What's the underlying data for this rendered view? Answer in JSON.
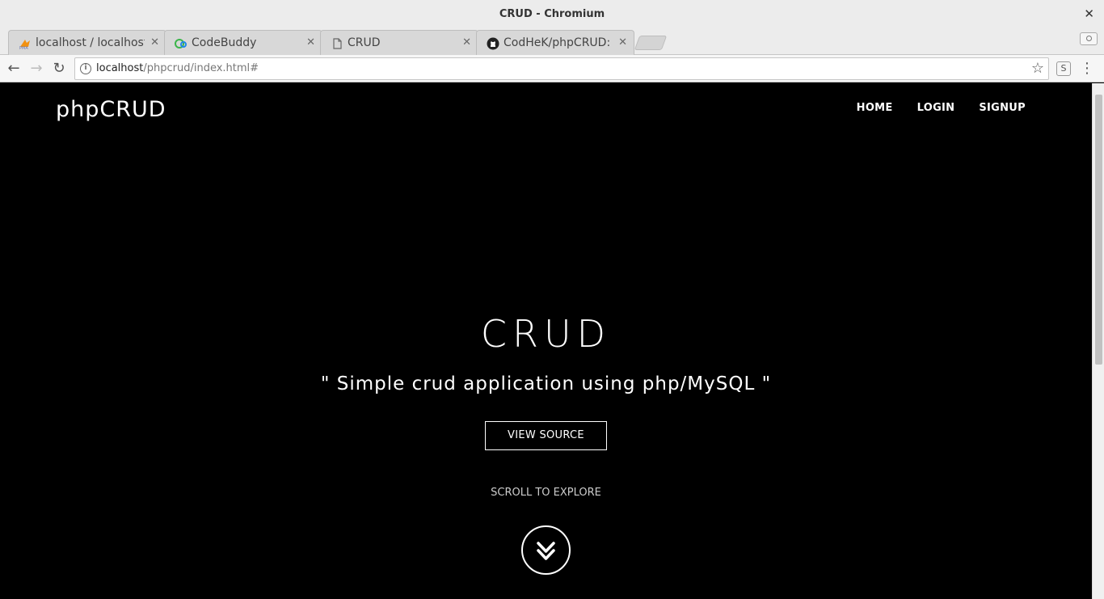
{
  "window": {
    "title": "CRUD - Chromium",
    "close_glyph": "✕"
  },
  "tabs": [
    {
      "title": "localhost / localhost",
      "icon": "phpmyadmin-icon",
      "close": "✕"
    },
    {
      "title": "CodeBuddy",
      "icon": "codebuddy-icon",
      "close": "✕"
    },
    {
      "title": "CRUD",
      "icon": "page-icon",
      "close": "✕"
    },
    {
      "title": "CodHeK/phpCRUD: A",
      "icon": "github-icon",
      "close": "✕"
    }
  ],
  "toolbar": {
    "back": "←",
    "forward": "→",
    "reload": "↻",
    "url_host": "localhost",
    "url_path": "/phpcrud/index.html#",
    "info": "i",
    "star": "☆",
    "extension": "S",
    "menu": "⋮"
  },
  "site": {
    "brand": "phpCRUD",
    "nav": [
      "HOME",
      "LOGIN",
      "SIGNUP"
    ],
    "hero_title": "CRUD",
    "hero_subtitle": "\" Simple crud application using php/MySQL \"",
    "cta": "VIEW SOURCE",
    "scroll_hint": "SCROLL TO EXPLORE"
  }
}
